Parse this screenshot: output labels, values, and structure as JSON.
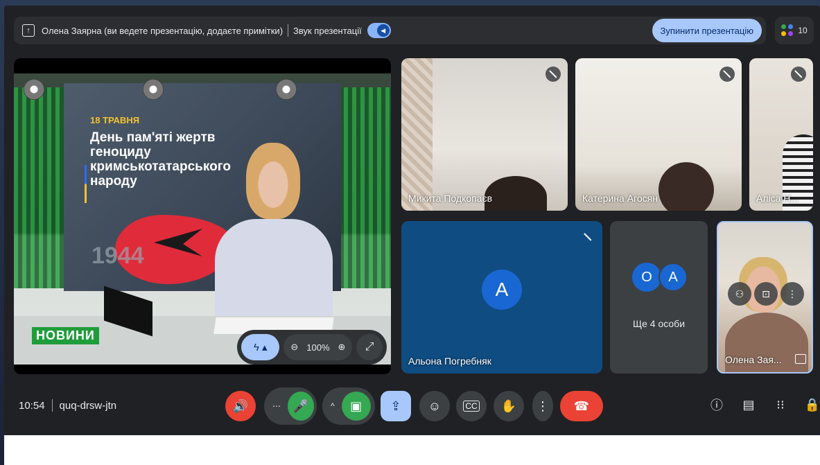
{
  "topbar": {
    "presenting_text": "Олена Заярна (ви ведете презентацію, додаєте примітки)",
    "audio_label": "Звук презентації",
    "stop_label": "Зупинити презентацію",
    "participant_count": "10"
  },
  "slide": {
    "date": "18 ТРАВНЯ",
    "headline": "День пам'яті жертв геноциду кримськотатарського народу",
    "year": "1944",
    "channel": "НОВИНИ",
    "zoom_level": "100%"
  },
  "tiles": {
    "mykyta": "Микита Подкопаєв",
    "kateryna": "Катерина Агосян",
    "alisa": "Аліса Н...",
    "alona": "Альона Погребняк",
    "alona_initial": "А",
    "more_initial_1": "О",
    "more_initial_2": "А",
    "more_label": "Ще 4 особи",
    "olena": "Олена Зая..."
  },
  "meeting": {
    "time": "10:54",
    "code": "quq-drsw-jtn"
  },
  "colors": {
    "accent": "#a8c7fa",
    "danger": "#ea4335",
    "green": "#34a853",
    "surface": "#202124"
  },
  "icons": {
    "present": "present-icon",
    "speaker": "speaker-icon",
    "mic": "mic-icon",
    "camera": "camera-icon",
    "present_now": "present-now-icon",
    "emoji": "emoji-icon",
    "captions": "captions-icon",
    "hand": "raise-hand-icon",
    "more": "more-vert-icon",
    "hangup": "hangup-icon",
    "info": "info-icon",
    "chat": "chat-icon",
    "activities": "activities-icon",
    "host": "host-controls-icon"
  }
}
